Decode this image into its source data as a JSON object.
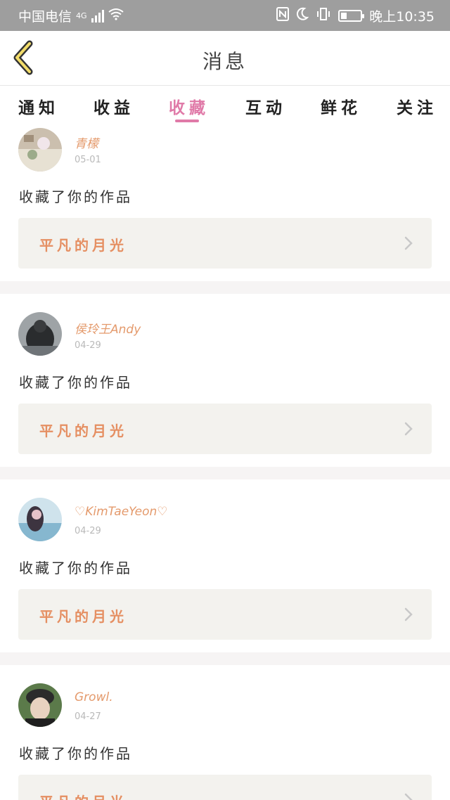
{
  "status": {
    "carrier": "中国电信",
    "network": "4G",
    "time": "晚上10:35"
  },
  "header": {
    "title": "消息"
  },
  "tabs": [
    {
      "label": "通知",
      "active": false
    },
    {
      "label": "收益",
      "active": false
    },
    {
      "label": "收藏",
      "active": true
    },
    {
      "label": "互动",
      "active": false
    },
    {
      "label": "鲜花",
      "active": false
    },
    {
      "label": "关注",
      "active": false
    }
  ],
  "items": [
    {
      "username": "青檬",
      "date": "05-01",
      "message": "收藏了你的作品",
      "work": "平凡的月光"
    },
    {
      "username": "侯玲王Andy",
      "date": "04-29",
      "message": "收藏了你的作品",
      "work": "平凡的月光"
    },
    {
      "username": "♡KimTaeYeon♡",
      "date": "04-29",
      "message": "收藏了你的作品",
      "work": "平凡的月光"
    },
    {
      "username": "Growl.",
      "date": "04-27",
      "message": "收藏了你的作品",
      "work": "平凡的月光"
    }
  ],
  "colors": {
    "accent": "#e07aa8",
    "username": "#e49a6c",
    "work_title": "#e58f62"
  },
  "icons": [
    "back-arrow-icon",
    "chevron-right-icon",
    "nfc-icon",
    "moon-icon",
    "vibrate-icon",
    "battery-icon",
    "signal-icon",
    "wifi-icon"
  ]
}
